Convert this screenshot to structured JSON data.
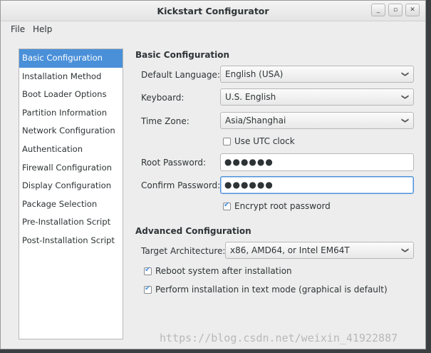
{
  "window": {
    "title": "Kickstart Configurator"
  },
  "menubar": {
    "file": "File",
    "help": "Help"
  },
  "sidebar": {
    "items": [
      {
        "label": "Basic Configuration"
      },
      {
        "label": "Installation Method"
      },
      {
        "label": "Boot Loader Options"
      },
      {
        "label": "Partition Information"
      },
      {
        "label": "Network Configuration"
      },
      {
        "label": "Authentication"
      },
      {
        "label": "Firewall Configuration"
      },
      {
        "label": "Display Configuration"
      },
      {
        "label": "Package Selection"
      },
      {
        "label": "Pre-Installation Script"
      },
      {
        "label": "Post-Installation Script"
      }
    ]
  },
  "basic": {
    "heading": "Basic Configuration",
    "language_label": "Default Language:",
    "language_value": "English (USA)",
    "keyboard_label": "Keyboard:",
    "keyboard_value": "U.S. English",
    "timezone_label": "Time Zone:",
    "timezone_value": "Asia/Shanghai",
    "utc_label": "Use UTC clock",
    "root_label": "Root Password:",
    "root_value": "●●●●●●",
    "confirm_label": "Confirm Password:",
    "confirm_value": "●●●●●●",
    "encrypt_label": "Encrypt root password"
  },
  "advanced": {
    "heading": "Advanced Configuration",
    "arch_label": "Target Architecture:",
    "arch_value": "x86, AMD64, or Intel EM64T",
    "reboot_label": "Reboot system after installation",
    "textmode_label": "Perform installation in text mode (graphical is default)"
  },
  "watermark": "https://blog.csdn.net/weixin_41922887"
}
